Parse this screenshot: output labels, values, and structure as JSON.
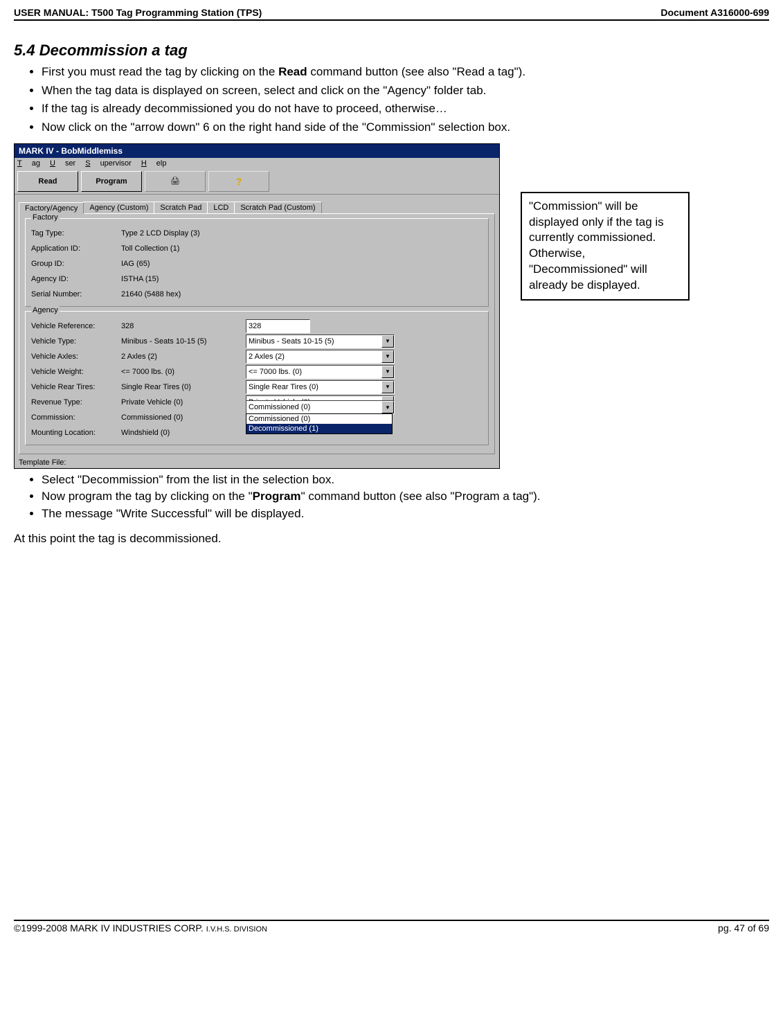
{
  "header": {
    "left": "USER MANUAL: T500 Tag Programming Station (TPS)",
    "right": "Document A316000-699"
  },
  "section_title": "5.4 Decommission a tag",
  "bullets_top": [
    "First you must read the tag by clicking on the <b>Read</b> command button (see also \"Read a tag\").",
    "When the tag data is displayed on screen, select and click on the \"Agency\" folder tab.",
    "If the tag is already decommissioned you do not have to proceed, otherwise…",
    "Now click on the \"arrow down\" 6 on the right hand side of the \"Commission\" selection box."
  ],
  "app": {
    "title": "MARK IV - BobMiddlemiss",
    "menus": [
      "Tag",
      "User",
      "Supervisor",
      "Help"
    ],
    "toolbar": {
      "read": "Read",
      "program": "Program"
    },
    "tabs": [
      "Factory/Agency",
      "Agency (Custom)",
      "Scratch Pad",
      "LCD",
      "Scratch Pad (Custom)"
    ],
    "factory_legend": "Factory",
    "factory_rows": [
      {
        "label": "Tag Type:",
        "value": "Type 2 LCD Display (3)"
      },
      {
        "label": "Application ID:",
        "value": "Toll Collection (1)"
      },
      {
        "label": "Group ID:",
        "value": "IAG (65)"
      },
      {
        "label": "Agency ID:",
        "value": "ISTHA (15)"
      },
      {
        "label": "Serial Number:",
        "value": "21640 (5488 hex)"
      }
    ],
    "agency_legend": "Agency",
    "agency_rows": [
      {
        "label": "Vehicle Reference:",
        "value": "328",
        "field_type": "text",
        "field": "328"
      },
      {
        "label": "Vehicle Type:",
        "value": "Minibus - Seats 10-15 (5)",
        "field_type": "combo",
        "field": "Minibus - Seats 10-15 (5)"
      },
      {
        "label": "Vehicle Axles:",
        "value": "2 Axles (2)",
        "field_type": "combo",
        "field": "2 Axles (2)"
      },
      {
        "label": "Vehicle Weight:",
        "value": "<= 7000 lbs. (0)",
        "field_type": "combo",
        "field": "<= 7000 lbs. (0)"
      },
      {
        "label": "Vehicle Rear Tires:",
        "value": "Single Rear Tires (0)",
        "field_type": "combo",
        "field": "Single Rear Tires (0)"
      },
      {
        "label": "Revenue Type:",
        "value": "Private Vehicle (0)",
        "field_type": "combo",
        "field": "Private Vehicle (0)"
      },
      {
        "label": "Commission:",
        "value": "Commissioned (0)",
        "field_type": "combo-open",
        "field": "Commissioned (0)",
        "options": [
          "Commissioned (0)",
          "Decommissioned (1)"
        ],
        "selected": 1
      },
      {
        "label": "Mounting Location:",
        "value": "Windshield (0)",
        "field_type": "none",
        "field": ""
      }
    ],
    "template_label": "Template File:"
  },
  "callout": "\"Commission\" will be displayed only if the tag is currently commissioned. Otherwise, \"Decommissioned\" will already be displayed.",
  "bullets_bottom": [
    "Select \"Decommission\" from the list in the selection box.",
    "Now program the tag by clicking on the \"<b>Program</b>\" command button (see also \"Program a tag\").",
    "The message \"Write Successful\" will be displayed."
  ],
  "closing": "At this point the tag is decommissioned.",
  "footer": {
    "left_a": "©1999-2008 MARK IV INDUSTRIES CORP. ",
    "left_b": "I.V.H.S. DIVISION",
    "right": "pg. 47 of 69"
  }
}
